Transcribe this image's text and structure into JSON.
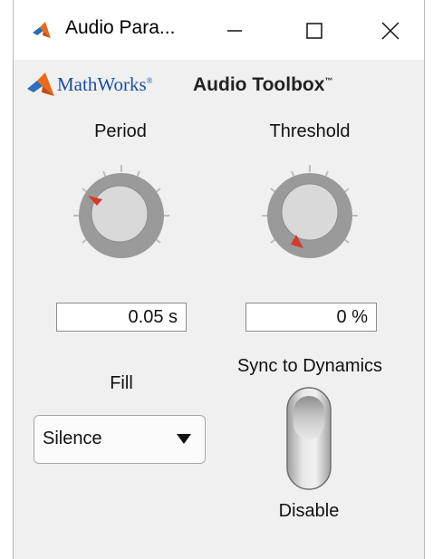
{
  "window": {
    "title": "Audio Para...",
    "controls": {
      "minimize_icon": "minimize-icon",
      "maximize_icon": "maximize-icon",
      "close_icon": "close-icon"
    }
  },
  "brand": {
    "company": "MathWorks",
    "product": "Audio Toolbox"
  },
  "params": {
    "period": {
      "label": "Period",
      "value": "0.05 s"
    },
    "threshold": {
      "label": "Threshold",
      "value": "0 %"
    },
    "fill": {
      "label": "Fill",
      "selected": "Silence"
    },
    "sync": {
      "label": "Sync to Dynamics",
      "state": "Disable"
    }
  },
  "colors": {
    "knob_outer": "#9a9a9a",
    "knob_inner": "#d9d9d9",
    "pointer": "#d43a2a",
    "brand_blue": "#1b4f9a",
    "background": "#f0f0f0"
  }
}
